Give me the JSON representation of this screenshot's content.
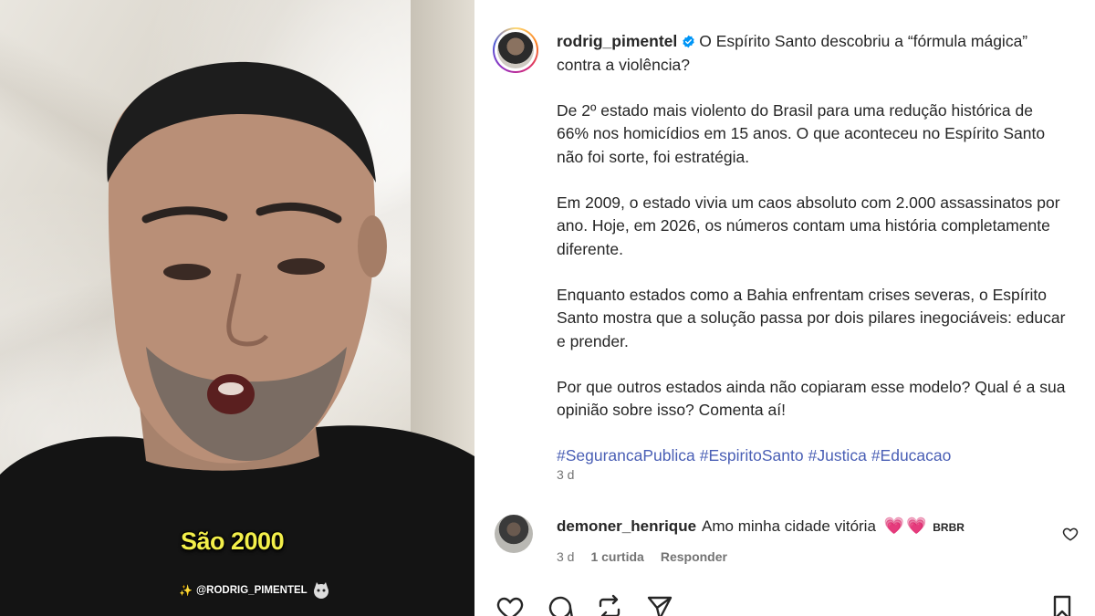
{
  "media": {
    "caption": "São 2000",
    "watermark": "@RODRIG_PIMENTEL"
  },
  "post": {
    "username": "rodrig_pimentel",
    "verified": true,
    "paragraphs": [
      "O Espírito Santo descobriu a “fórmula mágica” contra a violência?",
      "De 2º estado mais violento do Brasil para uma redução histórica de 66% nos homicídios em 15 anos. O que aconteceu no Espírito Santo não foi sorte, foi estratégia.",
      "Em 2009, o estado vivia um caos absoluto com 2.000 assassinatos por ano. Hoje, em 2026, os números contam uma história completamente diferente.",
      "Enquanto estados como a Bahia enfrentam crises severas, o Espírito Santo mostra que a solução passa por dois pilares inegociáveis: educar e prender.",
      "Por que outros estados ainda não copiaram esse modelo? Qual é a sua opinião sobre isso? Comenta aí!"
    ],
    "hashtags": [
      "#SegurancaPublica",
      "#EspiritoSanto",
      "#Justica",
      "#Educacao"
    ],
    "time": "3 d"
  },
  "comment": {
    "username": "demoner_henrique",
    "text": "Amo minha cidade vitória",
    "emoji1": "💗",
    "emoji2": "💗",
    "flag": "BRBR",
    "time": "3 d",
    "likes": "1 curtida",
    "reply": "Responder"
  },
  "colors": {
    "hashtag": "#4a5fb5",
    "verified": "#0095f6",
    "heart": "#e91e63",
    "caption": "#f3ef4a"
  },
  "icons": [
    "heart-icon",
    "comment-icon",
    "share-icon",
    "send-icon",
    "bookmark-icon",
    "verified-icon"
  ]
}
